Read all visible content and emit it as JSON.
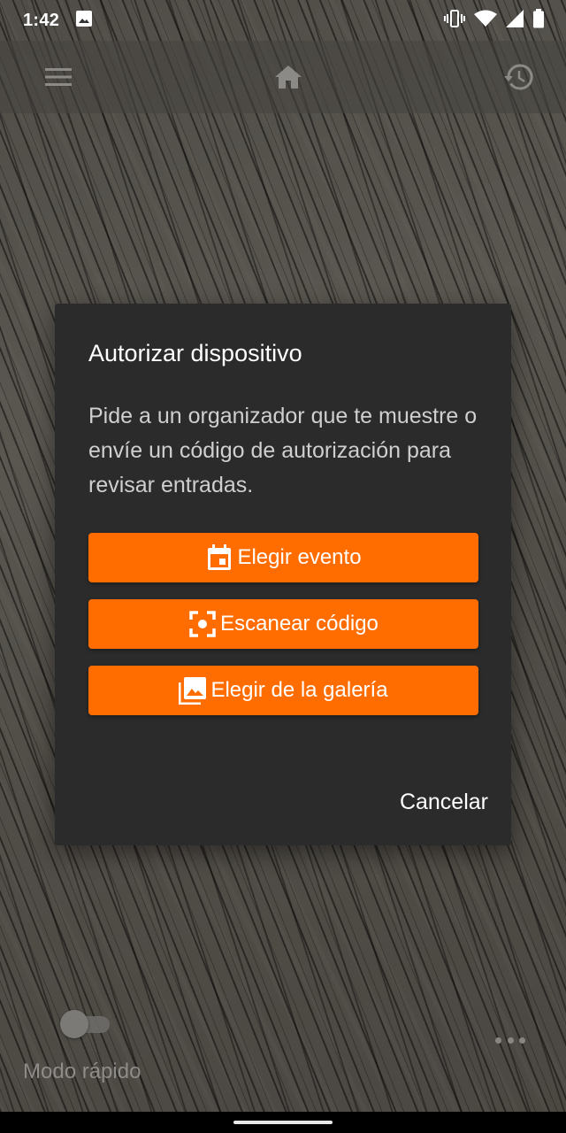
{
  "status_bar": {
    "time": "1:42",
    "icons": [
      "image-notification-icon",
      "vibrate-icon",
      "wifi-icon",
      "signal-icon",
      "battery-icon"
    ]
  },
  "app_bar": {
    "left_icon": "menu-icon",
    "center_icon": "home-icon",
    "right_icon": "history-icon"
  },
  "dialog": {
    "title": "Autorizar dispositivo",
    "message": "Pide a un organizador que te muestre o envíe un código de autorización para revisar entradas.",
    "buttons": [
      {
        "label": "Elegir evento",
        "icon": "calendar-event-icon"
      },
      {
        "label": "Escanear código",
        "icon": "scan-center-focus-icon"
      },
      {
        "label": "Elegir de la galería",
        "icon": "photo-library-icon"
      }
    ],
    "cancel_label": "Cancelar"
  },
  "bottom": {
    "fast_mode_label": "Modo rápido",
    "fast_mode_on": false
  },
  "colors": {
    "accent": "#ff6d00",
    "dialog_bg": "#2b2b2b"
  }
}
